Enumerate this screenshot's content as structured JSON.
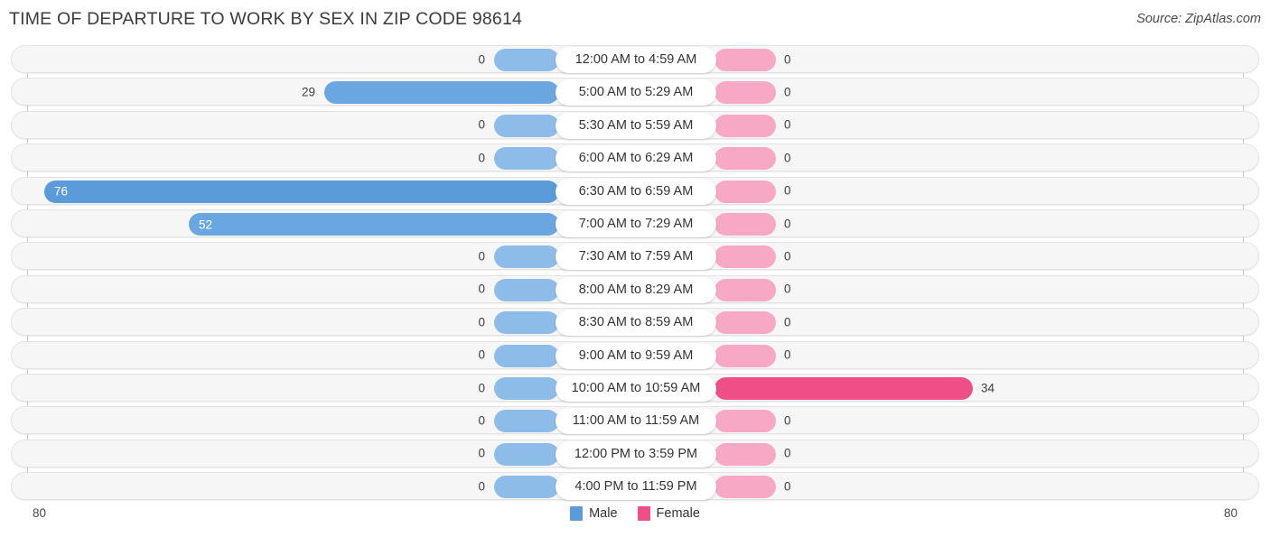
{
  "header": {
    "title": "TIME OF DEPARTURE TO WORK BY SEX IN ZIP CODE 98614",
    "source": "Source: ZipAtlas.com"
  },
  "legend": {
    "male": {
      "label": "Male",
      "color": "#5b9bd9"
    },
    "female": {
      "label": "Female",
      "color": "#ef4f86"
    }
  },
  "axis": {
    "left_max": "80",
    "right_max": "80"
  },
  "chart_data": {
    "type": "bar",
    "orientation": "horizontal-diverging",
    "title": "TIME OF DEPARTURE TO WORK BY SEX IN ZIP CODE 98614",
    "xlabel": "",
    "ylabel": "",
    "xlim": [
      80,
      80
    ],
    "grid": false,
    "legend_position": "bottom-center",
    "categories": [
      "12:00 AM to 4:59 AM",
      "5:00 AM to 5:29 AM",
      "5:30 AM to 5:59 AM",
      "6:00 AM to 6:29 AM",
      "6:30 AM to 6:59 AM",
      "7:00 AM to 7:29 AM",
      "7:30 AM to 7:59 AM",
      "8:00 AM to 8:29 AM",
      "8:30 AM to 8:59 AM",
      "9:00 AM to 9:59 AM",
      "10:00 AM to 10:59 AM",
      "11:00 AM to 11:59 AM",
      "12:00 PM to 3:59 PM",
      "4:00 PM to 11:59 PM"
    ],
    "series": [
      {
        "name": "Male",
        "values": [
          0,
          29,
          0,
          0,
          76,
          52,
          0,
          0,
          0,
          0,
          0,
          0,
          0,
          0
        ]
      },
      {
        "name": "Female",
        "values": [
          0,
          0,
          0,
          0,
          0,
          0,
          0,
          0,
          0,
          0,
          34,
          0,
          0,
          0
        ]
      }
    ]
  },
  "rows": [
    {
      "label": "12:00 AM to 4:59 AM",
      "male": "0",
      "female": "0",
      "male_w": 72,
      "female_w": 68,
      "male_tone": "",
      "female_tone": "",
      "male_inside": false,
      "female_inside": false
    },
    {
      "label": "5:00 AM to 5:29 AM",
      "male": "29",
      "female": "0",
      "male_w": 260,
      "female_w": 68,
      "male_tone": "v1",
      "female_tone": "",
      "male_inside": false,
      "female_inside": false
    },
    {
      "label": "5:30 AM to 5:59 AM",
      "male": "0",
      "female": "0",
      "male_w": 72,
      "female_w": 68,
      "male_tone": "",
      "female_tone": "",
      "male_inside": false,
      "female_inside": false
    },
    {
      "label": "6:00 AM to 6:29 AM",
      "male": "0",
      "female": "0",
      "male_w": 72,
      "female_w": 68,
      "male_tone": "",
      "female_tone": "",
      "male_inside": false,
      "female_inside": false
    },
    {
      "label": "6:30 AM to 6:59 AM",
      "male": "76",
      "female": "0",
      "male_w": 570,
      "female_w": 68,
      "male_tone": "v2",
      "female_tone": "",
      "male_inside": true,
      "female_inside": false
    },
    {
      "label": "7:00 AM to 7:29 AM",
      "male": "52",
      "female": "0",
      "male_w": 410,
      "female_w": 68,
      "male_tone": "v1",
      "female_tone": "",
      "male_inside": true,
      "female_inside": false
    },
    {
      "label": "7:30 AM to 7:59 AM",
      "male": "0",
      "female": "0",
      "male_w": 72,
      "female_w": 68,
      "male_tone": "",
      "female_tone": "",
      "male_inside": false,
      "female_inside": false
    },
    {
      "label": "8:00 AM to 8:29 AM",
      "male": "0",
      "female": "0",
      "male_w": 72,
      "female_w": 68,
      "male_tone": "",
      "female_tone": "",
      "male_inside": false,
      "female_inside": false
    },
    {
      "label": "8:30 AM to 8:59 AM",
      "male": "0",
      "female": "0",
      "male_w": 72,
      "female_w": 68,
      "male_tone": "",
      "female_tone": "",
      "male_inside": false,
      "female_inside": false
    },
    {
      "label": "9:00 AM to 9:59 AM",
      "male": "0",
      "female": "0",
      "male_w": 72,
      "female_w": 68,
      "male_tone": "",
      "female_tone": "",
      "male_inside": false,
      "female_inside": false
    },
    {
      "label": "10:00 AM to 10:59 AM",
      "male": "0",
      "female": "34",
      "male_w": 72,
      "female_w": 286,
      "male_tone": "",
      "female_tone": "v2",
      "male_inside": false,
      "female_inside": false
    },
    {
      "label": "11:00 AM to 11:59 AM",
      "male": "0",
      "female": "0",
      "male_w": 72,
      "female_w": 68,
      "male_tone": "",
      "female_tone": "",
      "male_inside": false,
      "female_inside": false
    },
    {
      "label": "12:00 PM to 3:59 PM",
      "male": "0",
      "female": "0",
      "male_w": 72,
      "female_w": 68,
      "male_tone": "",
      "female_tone": "",
      "male_inside": false,
      "female_inside": false
    },
    {
      "label": "4:00 PM to 11:59 PM",
      "male": "0",
      "female": "0",
      "male_w": 72,
      "female_w": 68,
      "male_tone": "",
      "female_tone": "",
      "male_inside": false,
      "female_inside": false
    }
  ]
}
